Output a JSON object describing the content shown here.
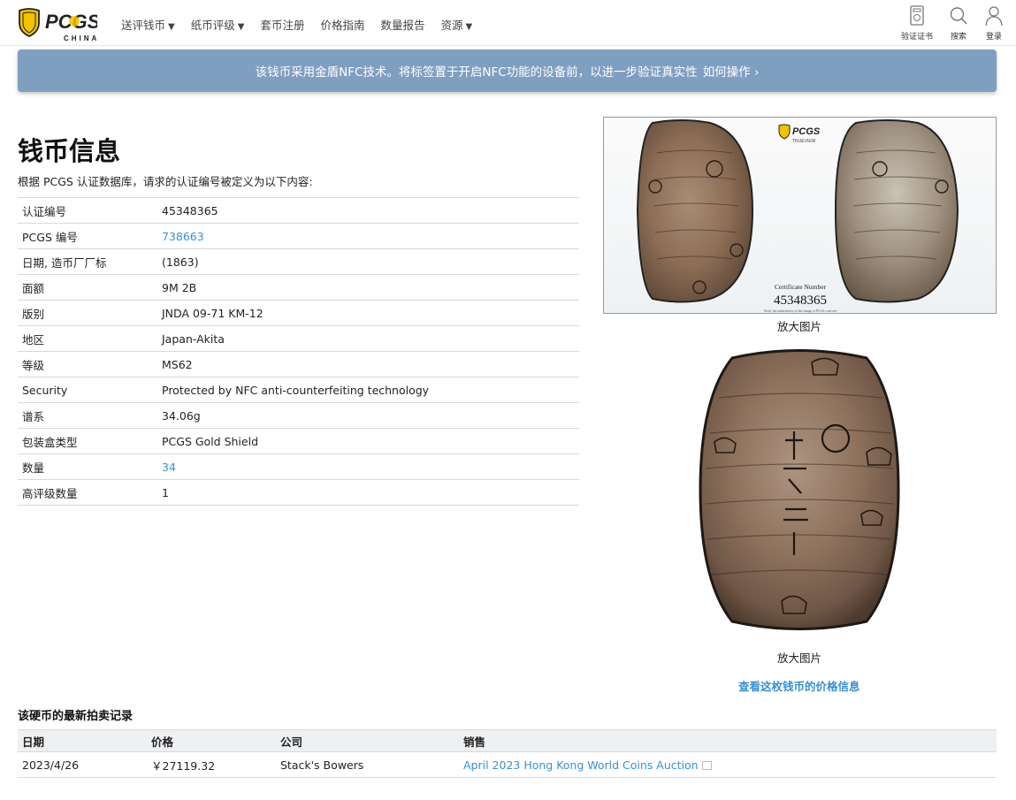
{
  "header": {
    "logo_text": "CHINA",
    "nav": [
      {
        "label": "送评钱币",
        "caret": "▼"
      },
      {
        "label": "纸币评级",
        "caret": "▼"
      },
      {
        "label": "套币注册",
        "caret": ""
      },
      {
        "label": "价格指南",
        "caret": ""
      },
      {
        "label": "数量报告",
        "caret": ""
      },
      {
        "label": "资源",
        "caret": "▼"
      }
    ],
    "tools": {
      "verify": "验证证书",
      "search": "搜索",
      "login": "登录"
    }
  },
  "banner": {
    "text": "该钱币采用金盾NFC技术。将标签置于开启NFC功能的设备前，以进一步验证真实性",
    "link": "如何操作 ›"
  },
  "coin_info": {
    "title": "钱币信息",
    "subtitle": "根据 PCGS 认证数据库，请求的认证编号被定义为以下内容:",
    "rows": [
      {
        "label": "认证编号",
        "value": "45348365"
      },
      {
        "label": "PCGS 编号",
        "value": "738663"
      },
      {
        "label": "日期, 造币厂厂标",
        "value": "(1863)"
      },
      {
        "label": "面额",
        "value": "9M 2B"
      },
      {
        "label": "版别",
        "value": "JNDA 09-71 KM-12"
      },
      {
        "label": "地区",
        "value": "Japan-Akita"
      },
      {
        "label": "等级",
        "value": "MS62"
      },
      {
        "label": "Security",
        "value": "Protected by NFC anti-counterfeiting technology"
      },
      {
        "label": "谱系",
        "value": "34.06g"
      },
      {
        "label": "包装盒类型",
        "value": "PCGS Gold Shield"
      },
      {
        "label": "数量",
        "value": "34"
      },
      {
        "label": "高评级数量",
        "value": "1"
      }
    ]
  },
  "images": {
    "holder_brand": "PCGS",
    "holder_sub": "TRUEVIEW",
    "cert_label": "Certificate Number",
    "cert_number": "45348365",
    "verify_note": "Verify the authenticity of this image at PCGS.com/cert",
    "enlarge_1": "放大图片",
    "enlarge_2": "放大图片",
    "price_link": "查看这枚钱币的价格信息"
  },
  "auction": {
    "title": "该硬币的最新拍卖记录",
    "headers": {
      "date": "日期",
      "price": "价格",
      "company": "公司",
      "sale": "销售"
    },
    "rows": [
      {
        "date": "2023/4/26",
        "price": "￥27119.32",
        "company": "Stack's Bowers",
        "sale": "April 2023 Hong Kong World Coins Auction"
      }
    ]
  },
  "colors": {
    "banner": "#7f9fc1",
    "link": "#3a8fd0",
    "logo_gold": "#f2c200"
  }
}
